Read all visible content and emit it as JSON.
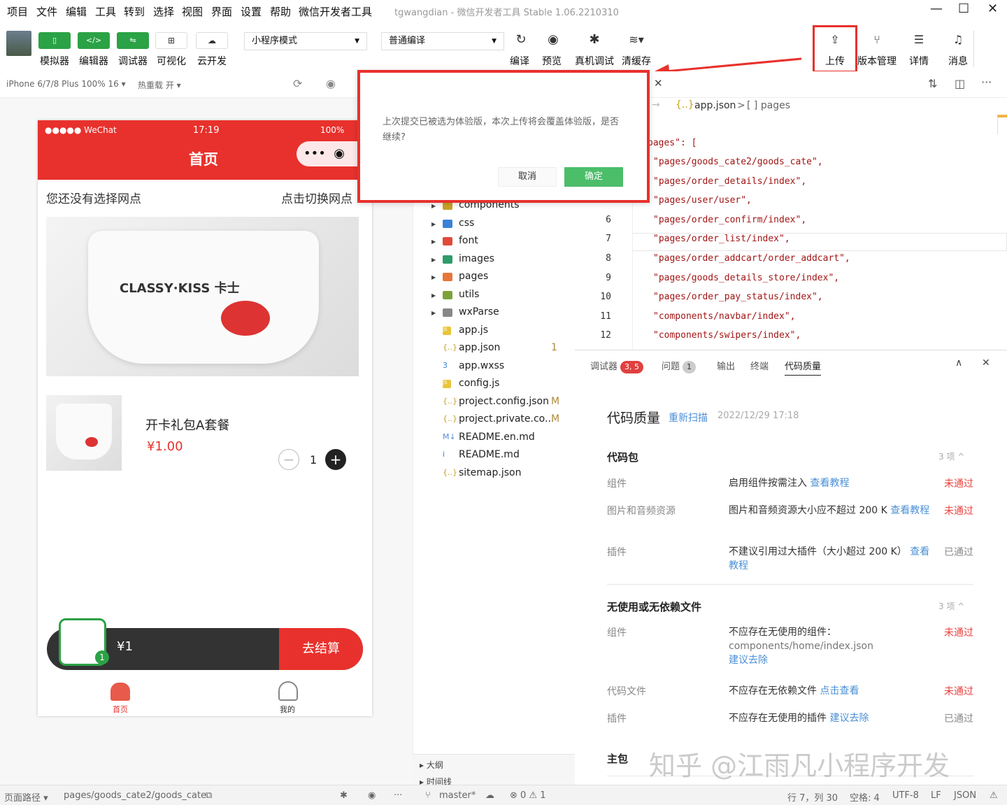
{
  "menu": [
    "项目",
    "文件",
    "编辑",
    "工具",
    "转到",
    "选择",
    "视图",
    "界面",
    "设置",
    "帮助",
    "微信开发者工具"
  ],
  "window_title": "tgwangdian - 微信开发者工具 Stable 1.06.2210310",
  "window_controls": {
    "minimize": "—",
    "maximize": "☐",
    "close": "✕"
  },
  "toolbar": {
    "simulator": "模拟器",
    "editor": "编辑器",
    "debugger": "调试器",
    "visual": "可视化",
    "cloud": "云开发",
    "mode_select": "小程序模式",
    "compile_select": "普通编译",
    "compile": "编译",
    "preview": "预览",
    "real_debug": "真机调试",
    "clear_cache": "清缓存",
    "upload": "上传",
    "version": "版本管理",
    "details": "详情",
    "messages": "消息"
  },
  "sim": {
    "device": "iPhone 6/7/8 Plus 100% 16 ▾",
    "hot_reload": "热重载 开 ▾"
  },
  "phone": {
    "carrier": "●●●●● WeChat",
    "time": "17:19",
    "battery": "100%",
    "title": "首页",
    "notice_left": "您还没有选择网点",
    "notice_right": "点击切换网点",
    "banner_brand": "CLASSY·KISS 卡士",
    "product_name": "开卡礼包A套餐",
    "product_price": "¥1.00",
    "qty": "1",
    "cart_total": "¥1",
    "cart_badge": "1",
    "checkout": "去结算",
    "tab_home": "首页",
    "tab_mine": "我的"
  },
  "dialog": {
    "message": "上次提交已被选为体验版，本次上传将会覆盖体验版，是否继续?",
    "cancel": "取消",
    "confirm": "确定"
  },
  "tree": [
    {
      "name": "components",
      "color": "#c9a227",
      "folder": true
    },
    {
      "name": "css",
      "color": "#3b82d6",
      "folder": true
    },
    {
      "name": "font",
      "color": "#e04a3a",
      "folder": true
    },
    {
      "name": "images",
      "color": "#2e9c6a",
      "folder": true
    },
    {
      "name": "pages",
      "color": "#e8763a",
      "folder": true
    },
    {
      "name": "utils",
      "color": "#7ca33a",
      "folder": true
    },
    {
      "name": "wxParse",
      "color": "#888",
      "folder": true
    },
    {
      "name": "app.js",
      "color": "#e8c53a",
      "folder": false,
      "status": ""
    },
    {
      "name": "app.json",
      "color": "#c9a227",
      "folder": false,
      "status": "1",
      "ty": "{..}"
    },
    {
      "name": "app.wxss",
      "color": "#3b82d6",
      "folder": false,
      "status": "",
      "ty": "3"
    },
    {
      "name": "config.js",
      "color": "#e8c53a",
      "folder": false,
      "status": ""
    },
    {
      "name": "project.config.json",
      "color": "#c9a227",
      "folder": false,
      "status": "M",
      "ty": "{..}"
    },
    {
      "name": "project.private.co...",
      "color": "#c9a227",
      "folder": false,
      "status": "M",
      "ty": "{..}"
    },
    {
      "name": "README.en.md",
      "color": "#5b8fd6",
      "folder": false,
      "status": "",
      "ty": "M↓"
    },
    {
      "name": "README.md",
      "color": "#3b82d6",
      "folder": false,
      "status": "",
      "ty": "i"
    },
    {
      "name": "sitemap.json",
      "color": "#c9a227",
      "folder": false,
      "status": "",
      "ty": "{..}"
    }
  ],
  "tree_bottom": {
    "outline": "大纲",
    "timeline": "时间线"
  },
  "editor": {
    "breadcrumb_file": "app.json",
    "breadcrumb_sep": ">",
    "breadcrumb_key": "[ ] pages",
    "pages_key": "pages\": [",
    "lines": [
      {
        "n": "",
        "c": "\"pages/goods_cate2/goods_cate\","
      },
      {
        "n": "",
        "c": "\"pages/order_details/index\","
      },
      {
        "n": "",
        "c": "\"pages/user/user\","
      },
      {
        "n": "6",
        "c": "\"pages/order_confirm/index\","
      },
      {
        "n": "7",
        "c": "\"pages/order_list/index\","
      },
      {
        "n": "8",
        "c": "\"pages/order_addcart/order_addcart\","
      },
      {
        "n": "9",
        "c": "\"pages/goods_details_store/index\","
      },
      {
        "n": "10",
        "c": "\"pages/order_pay_status/index\","
      },
      {
        "n": "11",
        "c": "\"components/navbar/index\","
      },
      {
        "n": "12",
        "c": "\"components/swipers/index\","
      }
    ]
  },
  "panel": {
    "tabs": {
      "debugger": "调试器",
      "debugger_badge": "3, 5",
      "issues": "问题",
      "issues_badge": "1",
      "output": "输出",
      "terminal": "终端",
      "quality": "代码质量"
    },
    "title": "代码质量",
    "rescan": "重新扫描",
    "date": "2022/12/29 17:18",
    "sec1": {
      "title": "代码包",
      "count": "3 项 ^"
    },
    "r1": {
      "k": "组件",
      "v": "启用组件按需注入 ",
      "link": "查看教程",
      "s": "未通过"
    },
    "r2": {
      "k": "图片和音频资源",
      "v": "图片和音频资源大小应不超过 200 K ",
      "link": "查看教程",
      "s": "未通过"
    },
    "r3": {
      "k": "插件",
      "v": "不建议引用过大插件（大小超过 200 K） ",
      "link": "查看教程",
      "s": "已通过"
    },
    "sec2": {
      "title": "无使用或无依赖文件",
      "count": "3 项 ^"
    },
    "r4": {
      "k": "组件",
      "v": "不应存在无使用的组件：",
      "v2": "components/home/index.json",
      "link": "建议去除",
      "s": "未通过"
    },
    "r5": {
      "k": "代码文件",
      "v": "不应存在无依赖文件 ",
      "link": "点击查看",
      "s": "未通过"
    },
    "r6": {
      "k": "插件",
      "v": "不应存在无使用的插件 ",
      "link": "建议去除",
      "s": "已通过"
    },
    "sec3": {
      "title": "主包"
    }
  },
  "watermark": "知乎 @江雨凡小程序开发",
  "status": {
    "path_label": "页面路径 ▾",
    "path": "pages/goods_cate2/goods_cate",
    "branch": "master*",
    "errors": "⊗ 0 ⚠ 1",
    "pos": "行 7，列 30",
    "spaces": "空格: 4",
    "enc": "UTF-8",
    "eol": "LF",
    "lang": "JSON"
  },
  "colors": {
    "accent_green": "#2ba245",
    "highlight_red": "#e8312c",
    "link_blue": "#4a8fd6",
    "fail_red": "#e8423e"
  }
}
